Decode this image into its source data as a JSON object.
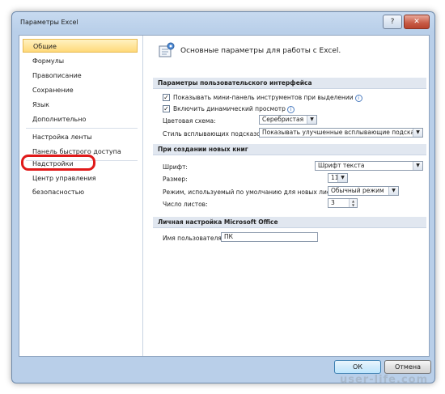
{
  "window": {
    "title": "Параметры Excel",
    "help_label": "?",
    "close_label": "✕"
  },
  "sidebar": {
    "items": [
      {
        "label": "Общие"
      },
      {
        "label": "Формулы"
      },
      {
        "label": "Правописание"
      },
      {
        "label": "Сохранение"
      },
      {
        "label": "Язык"
      },
      {
        "label": "Дополнительно"
      },
      {
        "label": "Настройка ленты"
      },
      {
        "label": "Панель быстрого доступа"
      },
      {
        "label": "Надстройки"
      },
      {
        "label": "Центр управления безопасностью"
      }
    ],
    "active_index": 0,
    "highlighted_item": "Надстройки",
    "highlight_color": "#e01a1a"
  },
  "main": {
    "header": "Основные параметры для работы с Excel.",
    "ui_section": {
      "title": "Параметры пользовательского интерфейса",
      "minibar_label": "Показывать мини-панель инструментов при выделении",
      "minibar_checked": true,
      "live_preview_label": "Включить динамический просмотр",
      "live_preview_checked": true,
      "color_scheme_label": "Цветовая схема:",
      "color_scheme_value": "Серебристая",
      "tooltip_style_label": "Стиль всплывающих подсказок:",
      "tooltip_style_value": "Показывать улучшенные всплывающие подсказки"
    },
    "workbook_section": {
      "title": "При создании новых книг",
      "font_label": "Шрифт:",
      "font_value": "Шрифт текста",
      "size_label": "Размер:",
      "size_value": "11",
      "view_label": "Режим, используемый по умолчанию для новых листов:",
      "view_value": "Обычный режим",
      "sheets_label": "Число листов:",
      "sheets_value": "3"
    },
    "personal_section": {
      "title": "Личная настройка Microsoft Office",
      "username_label": "Имя пользователя:",
      "username_value": "ПК"
    }
  },
  "footer": {
    "ok_label": "ОК",
    "cancel_label": "Отмена"
  },
  "watermark": "user-life.com",
  "icons": {
    "info": "info-icon",
    "header": "options-icon",
    "dropdown": "chevron-down-icon"
  }
}
